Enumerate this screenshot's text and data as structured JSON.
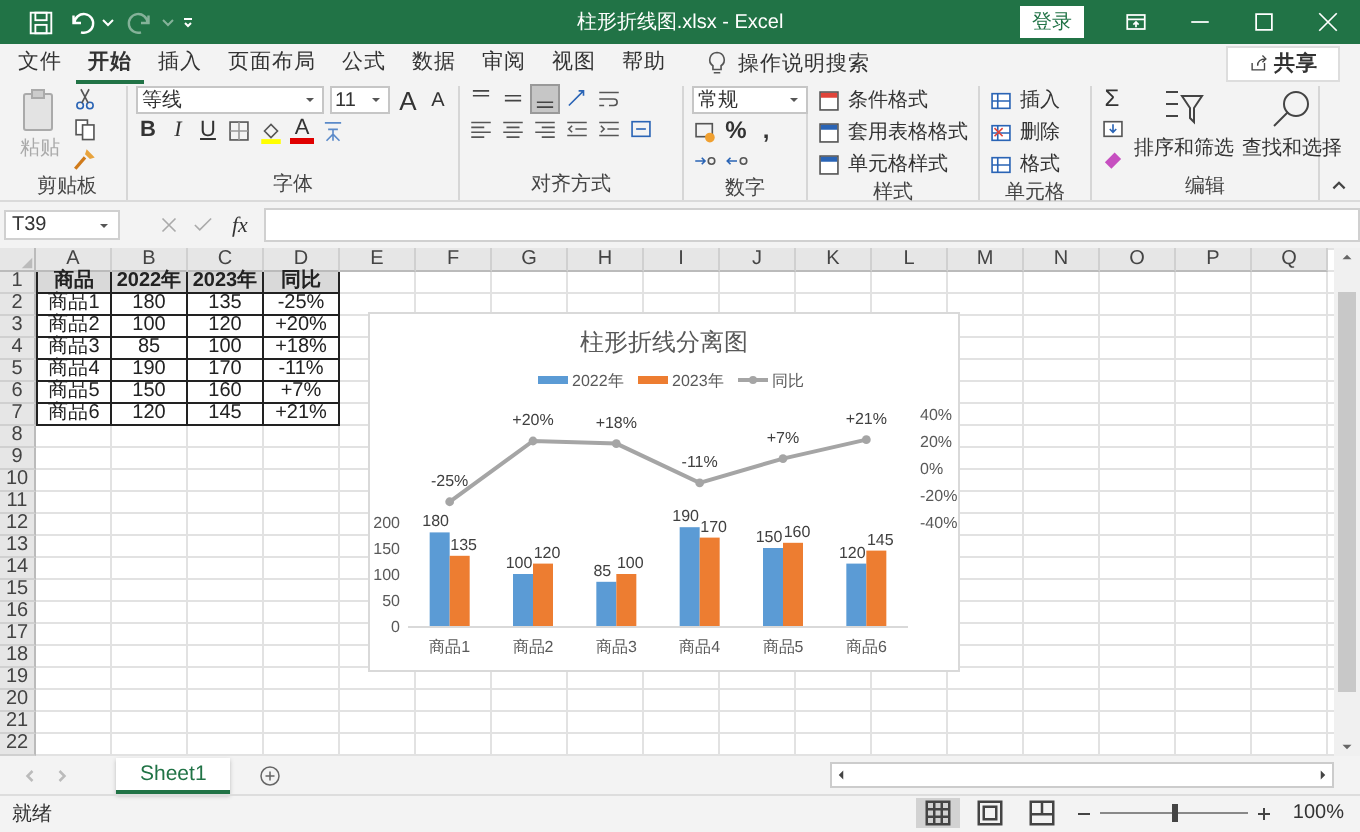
{
  "title_bar": {
    "redo_disabled": true,
    "title": "柱形折线图.xlsx  -  Excel",
    "login": "登录"
  },
  "menu_tabs": [
    {
      "label": "文件",
      "selected": false
    },
    {
      "label": "开始",
      "selected": true
    },
    {
      "label": "插入",
      "selected": false
    },
    {
      "label": "页面布局",
      "selected": false
    },
    {
      "label": "公式",
      "selected": false
    },
    {
      "label": "数据",
      "selected": false
    },
    {
      "label": "审阅",
      "selected": false
    },
    {
      "label": "视图",
      "selected": false
    },
    {
      "label": "帮助",
      "selected": false
    }
  ],
  "tell_me": "操作说明搜索",
  "share": "共享",
  "ribbon": {
    "clipboard": {
      "paste": {
        "label": "粘贴",
        "disabled": true
      },
      "label": "剪贴板"
    },
    "font": {
      "font_name": "等线",
      "font_size": "11",
      "grow": "A",
      "shrink": "A",
      "styles": [
        "B",
        "I",
        "U"
      ],
      "font_color": "A",
      "label": "字体"
    },
    "alignment": {
      "vertical_align": [
        {
          "selected": false
        },
        {
          "selected": false
        },
        {
          "selected": true
        }
      ],
      "label": "对齐方式"
    },
    "number": {
      "format": "常规",
      "percent": "%",
      "comma": ",",
      "label": "数字"
    },
    "styles": {
      "items": [
        "条件格式",
        "套用表格格式",
        "单元格样式"
      ],
      "label": "样式"
    },
    "cells": {
      "items": [
        "插入",
        "删除",
        "格式"
      ],
      "label": "单元格"
    },
    "editing": {
      "autosum": "Σ",
      "sort_filter": "排序和筛选",
      "find_select": "查找和选择",
      "label": "编辑"
    }
  },
  "formula_bar": {
    "name_box": "T39",
    "fx": "fx"
  },
  "sheet": {
    "columns": [
      "A",
      "B",
      "C",
      "D",
      "E",
      "F",
      "G",
      "H",
      "I",
      "J",
      "K",
      "L",
      "M",
      "N",
      "O",
      "P",
      "Q"
    ],
    "row_numbers": [
      "1",
      "2",
      "3",
      "4",
      "5",
      "6",
      "7",
      "8",
      "9",
      "10",
      "11",
      "12",
      "13",
      "14",
      "15",
      "16",
      "17",
      "18",
      "19",
      "20",
      "21",
      "22"
    ],
    "rows": [
      [
        "商品",
        "2022年",
        "2023年",
        "同比"
      ],
      [
        "商品1",
        "180",
        "135",
        "-25%"
      ],
      [
        "商品2",
        "100",
        "120",
        "+20%"
      ],
      [
        "商品3",
        "85",
        "100",
        "+18%"
      ],
      [
        "商品4",
        "190",
        "170",
        "-11%"
      ],
      [
        "商品5",
        "150",
        "160",
        "+7%"
      ],
      [
        "商品6",
        "120",
        "145",
        "+21%"
      ]
    ]
  },
  "chart_panel": {
    "line_chart": {
      "chart_data": {
        "type": "line",
        "title": "柱形折线分离图",
        "legend": "top",
        "series": [
          {
            "name": "同比",
            "color": "#a5a5a5",
            "marker": true,
            "values": [
              -0.25,
              0.2,
              0.18,
              -0.11,
              0.07,
              0.21
            ]
          }
        ],
        "value_labels": [
          "-25%",
          "+20%",
          "+18%",
          "-11%",
          "+7%",
          "+21%"
        ],
        "ylim": [
          -0.4,
          0.4
        ],
        "yticks": [
          {
            "value": 0.4,
            "label": "40%"
          },
          {
            "value": 0.2,
            "label": "20%"
          },
          {
            "value": 0,
            "label": "0%"
          },
          {
            "value": -0.2,
            "label": "-20%"
          },
          {
            "value": -0.4,
            "label": "-40%"
          }
        ]
      }
    },
    "bar_chart": {
      "chart_data": {
        "type": "bar",
        "categories": [
          "商品1",
          "商品2",
          "商品3",
          "商品4",
          "商品5",
          "商品6"
        ],
        "series": [
          {
            "name": "2022年",
            "color": "#5b9bd5",
            "values": [
              180,
              100,
              85,
              190,
              150,
              120
            ]
          },
          {
            "name": "2023年",
            "color": "#ed7d31",
            "values": [
              135,
              120,
              100,
              170,
              160,
              145
            ]
          }
        ],
        "ylim": [
          0,
          200
        ],
        "yticks": [
          0,
          50,
          100,
          150,
          200
        ],
        "data_labels": true
      }
    }
  },
  "sheet_tabs": [
    {
      "label": "Sheet1",
      "selected": true
    }
  ],
  "status_bar": {
    "status": "就绪",
    "views": [
      {
        "selected": true
      },
      {
        "selected": false
      },
      {
        "selected": false
      }
    ],
    "zoom": {
      "level": 0.5,
      "label": "100%"
    }
  }
}
